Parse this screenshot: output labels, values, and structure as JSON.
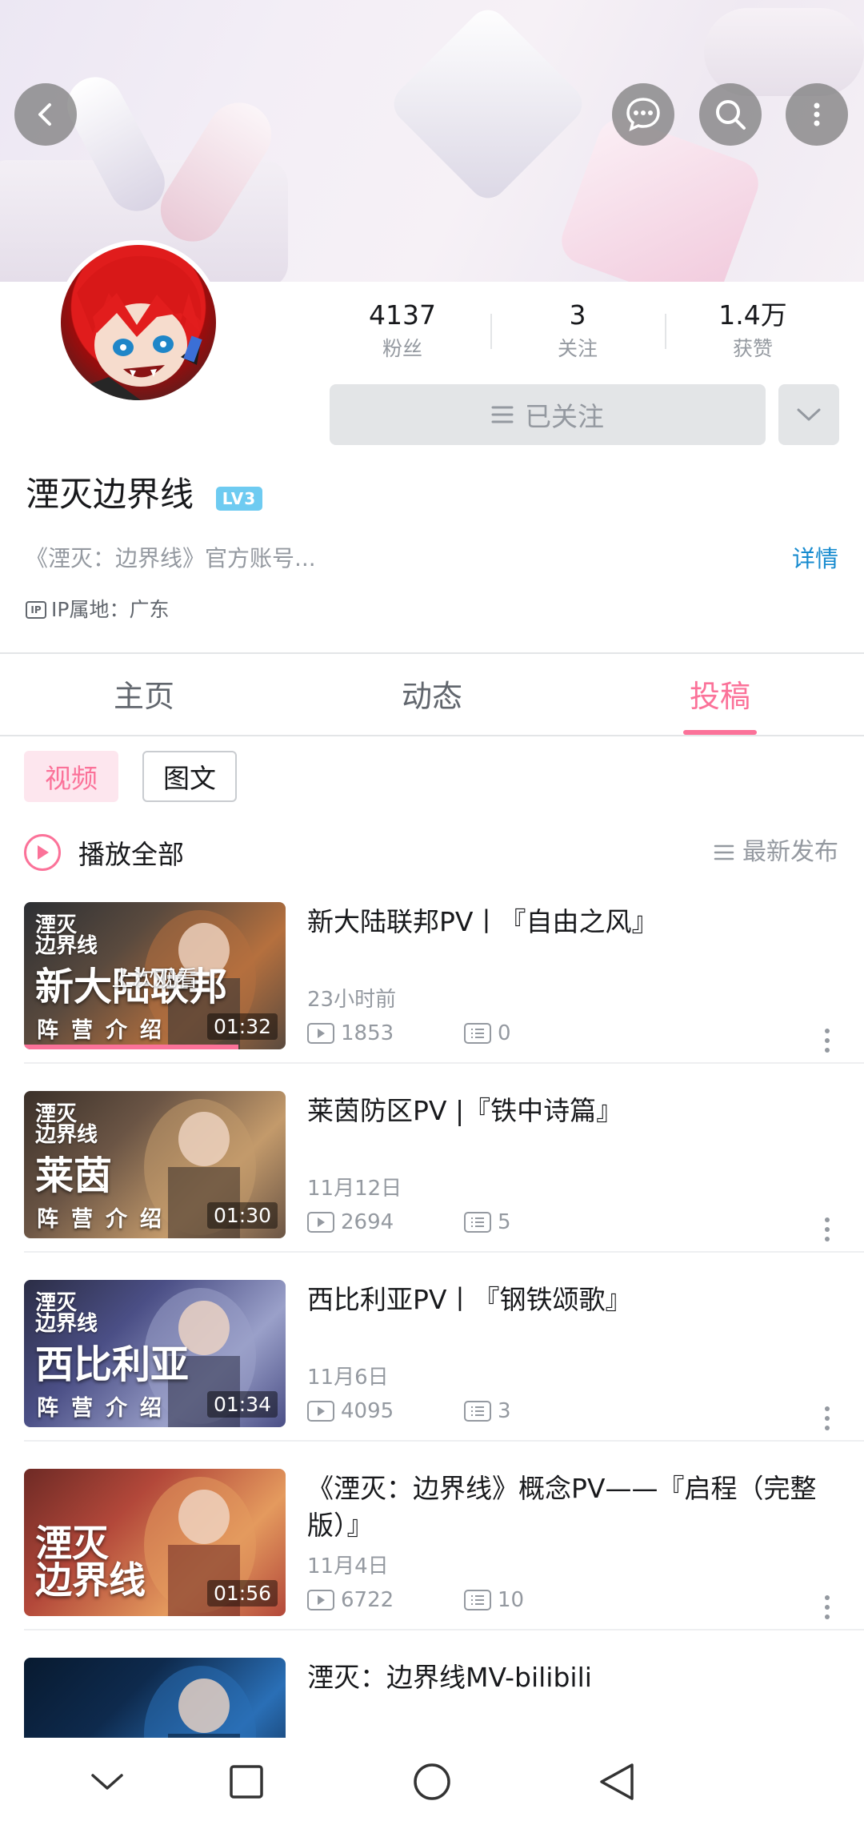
{
  "stats": [
    {
      "value": "4137",
      "label": "粉丝"
    },
    {
      "value": "3",
      "label": "关注"
    },
    {
      "value": "1.4万",
      "label": "获赞"
    }
  ],
  "follow_button": "已关注",
  "profile": {
    "name": "湮灭边界线",
    "level": "LV3",
    "bio": "《湮灭：边界线》官方账号...",
    "detail_link": "详情",
    "ip_badge": "IP",
    "ip_location": "IP属地：广东"
  },
  "tabs": [
    "主页",
    "动态",
    "投稿"
  ],
  "active_tab": 2,
  "filters": [
    "视频",
    "图文"
  ],
  "play_all": "播放全部",
  "sort": "最新发布",
  "videos": [
    {
      "title": "新大陆联邦PV丨『自由之风』",
      "date": "23小时前",
      "views": "1853",
      "comments": "0",
      "duration": "01:32",
      "thumb_logo": "湮灭\n边界线",
      "thumb_title": "新大陆联邦",
      "thumb_sub": "阵营介绍",
      "last_watched": "上次观看",
      "progress": 0.82,
      "colors": [
        "#5a4a3e",
        "#b5703e",
        "#2c2f33"
      ]
    },
    {
      "title": "莱茵防区PV |『铁中诗篇』",
      "date": "11月12日",
      "views": "2694",
      "comments": "5",
      "duration": "01:30",
      "thumb_logo": "湮灭\n边界线",
      "thumb_title": "莱茵",
      "thumb_sub": "阵营介绍",
      "colors": [
        "#6b5545",
        "#c39a6b",
        "#3a3029"
      ]
    },
    {
      "title": "西比利亚PV丨『钢铁颂歌』",
      "date": "11月6日",
      "views": "4095",
      "comments": "3",
      "duration": "01:34",
      "thumb_logo": "湮灭\n边界线",
      "thumb_title": "西比利亚",
      "thumb_sub": "阵营介绍",
      "colors": [
        "#4b4f86",
        "#9aa0c9",
        "#2b2d45"
      ]
    },
    {
      "title": "《湮灭：边界线》概念PV——『启程（完整版）』",
      "date": "11月4日",
      "views": "6722",
      "comments": "10",
      "duration": "01:56",
      "thumb_logo": "",
      "thumb_title": "湮灭\n边界线",
      "thumb_sub": "",
      "colors": [
        "#b3483a",
        "#e49a5e",
        "#6e2a25"
      ]
    },
    {
      "title": "湮灭：边界线MV-bilibili",
      "colors": [
        "#0e2a4d",
        "#2a6fb6",
        "#081a30"
      ]
    }
  ],
  "icons": {
    "back": "back-arrow-icon",
    "chat": "chat-bubble-icon",
    "search": "search-icon",
    "more": "more-vertical-icon"
  },
  "accent_color": "#fb7299"
}
